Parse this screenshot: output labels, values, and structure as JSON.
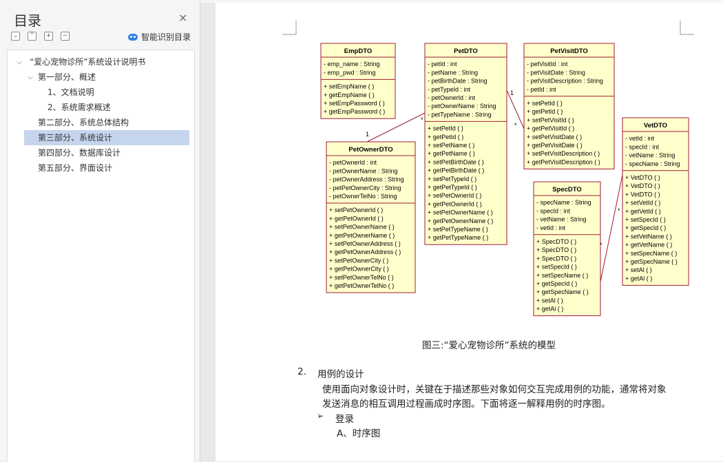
{
  "sidebar": {
    "title": "目录",
    "close_icon": "×",
    "smart_label": "智能识别目录",
    "toolbar": {
      "collapse": "⌄",
      "expand": "⌃",
      "add": "+",
      "remove": "−"
    },
    "items": [
      {
        "label": "“爱心宠物诊所”系统设计说明书",
        "level": 0,
        "expanded": true
      },
      {
        "label": "第一部分、概述",
        "level": 1,
        "expanded": true
      },
      {
        "label": "1、文档说明",
        "level": 2
      },
      {
        "label": "2、系统需求概述",
        "level": 2
      },
      {
        "label": "第二部分、系统总体结构",
        "level": 1
      },
      {
        "label": "第三部分、系统设计",
        "level": 1,
        "selected": true
      },
      {
        "label": "第四部分、数据库设计",
        "level": 1
      },
      {
        "label": "第五部分、界面设计",
        "level": 1
      }
    ]
  },
  "uml": {
    "classes": [
      {
        "name": "EmpDTO",
        "attrs": [
          "- emp_name : String",
          "- emp_pwd : String"
        ],
        "methods": [
          "+ setEmpName ( )",
          "+ getEmpName ( )",
          "+ setEmpPassword ( )",
          "+ getEmpPassword ( )"
        ]
      },
      {
        "name": "PetDTO",
        "attrs": [
          "- petId : int",
          "- petName : String",
          "- petBirthDate : String",
          "- petTypeId : int",
          "- petOwnerId : int",
          "- petOwnerName : String",
          "- petTypeName : String"
        ],
        "methods": [
          "+ setPetId ( )",
          "+ getPetId ( )",
          "+ setPetName ( )",
          "+ getPetName ( )",
          "+ setPetBirthDate ( )",
          "+ getPetBirthDate ( )",
          "+ setPetTypeId ( )",
          "+ getPetTypeId ( )",
          "+ setPetOwnerId ( )",
          "+ getPetOwnerId ( )",
          "+ setPetOwnerName ( )",
          "+ getPetOwnerName ( )",
          "+ setPetTypeName ( )",
          "+ getPetTypeName ( )"
        ]
      },
      {
        "name": "PetVisitDTO",
        "attrs": [
          "- petVisitId : int",
          "- petVisitDate : String",
          "- petVisitDescription : String",
          "- petId : int"
        ],
        "methods": [
          "+ setPetId ( )",
          "+ getPetId ( )",
          "+ setPetVisitId ( )",
          "+ getPetVisitId ( )",
          "+ setPetVisitDate ( )",
          "+ getPetVisitDate ( )",
          "+ setPetVisitDescription ( )",
          "+ getPetVisitDescription ( )"
        ]
      },
      {
        "name": "PetOwnerDTO",
        "attrs": [
          "- petOwnerId : int",
          "- petOwnerName : String",
          "- petOwnerAddress : String",
          "- petPetOwnerCity : String",
          "- petOwnerTelNo : String"
        ],
        "methods": [
          "+ setPetOwnerId ( )",
          "+ getPetOwnerId ( )",
          "+ setPetOwnerName ( )",
          "+ getPetOwnerName ( )",
          "+ setPetOwnerAddress ( )",
          "+ getPetOwnerAddress ( )",
          "+ setPetOwnerCity ( )",
          "+ getPetOwnerCity ( )",
          "+ setPetOwnerTelNo ( )",
          "+ getPetOwnerTelNo ( )"
        ]
      },
      {
        "name": "SpecDTO",
        "attrs": [
          "- specName : String",
          "- specId : int",
          "- vetName : String",
          "- vetId : int"
        ],
        "methods": [
          "+ SpecDTO ( )",
          "+ SpecDTO ( )",
          "+ SpecDTO ( )",
          "+ setSpecId ( )",
          "+ setSpecName ( )",
          "+ getSpecId ( )",
          "+ getSpecName ( )",
          "+ setAl ( )",
          "+ getAl ( )"
        ]
      },
      {
        "name": "VetDTO",
        "attrs": [
          "- vetId : int",
          "- specId : int",
          "- vetName : String",
          "- specName : String"
        ],
        "methods": [
          "+ VetDTO ( )",
          "+ VetDTO ( )",
          "+ VetDTO ( )",
          "+ setVetId ( )",
          "+ getVetId ( )",
          "+ setSpecId ( )",
          "+ getSpecId ( )",
          "+ setVetName ( )",
          "+ getVetName ( )",
          "+ setSpecName ( )",
          "+ getSpecName ( )",
          "+ setAl ( )",
          "+ getAl ( )"
        ]
      }
    ],
    "multiplicities": {
      "owner_pet_owner": "1",
      "owner_pet_pet": "*",
      "pet_visit_pet": "1",
      "pet_visit_visit": "*",
      "spec_vet_spec": "*",
      "spec_vet_vet": "*"
    }
  },
  "doc": {
    "caption": "图三:“爱心宠物诊所”系统的模型",
    "section_num": "2.",
    "section_title": "用例的设计",
    "para_line1": "使用面向对象设计时，关键在于描述那些对象如何交互完成用例的功能，通常将对象",
    "para_line2": "发送消息的相互调用过程画成时序图。下面将逐一解释用例的时序图。",
    "bullet": "➢",
    "bullet_text": "登录",
    "sub_item": "A、时序图"
  }
}
